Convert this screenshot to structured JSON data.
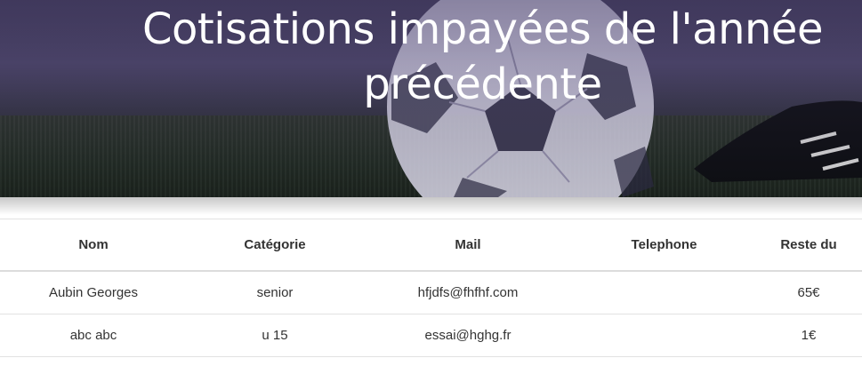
{
  "hero": {
    "title": "Cotisations impayées de l'année précédente"
  },
  "table": {
    "columns": [
      "Nom",
      "Catégorie",
      "Mail",
      "Telephone",
      "Reste du"
    ],
    "rows": [
      {
        "nom": "Aubin Georges",
        "categorie": "senior",
        "mail": "hfjdfs@fhfhf.com",
        "telephone": "",
        "reste": "65€"
      },
      {
        "nom": "abc abc",
        "categorie": "u 15",
        "mail": "essai@hghg.fr",
        "telephone": "",
        "reste": "1€"
      }
    ]
  }
}
